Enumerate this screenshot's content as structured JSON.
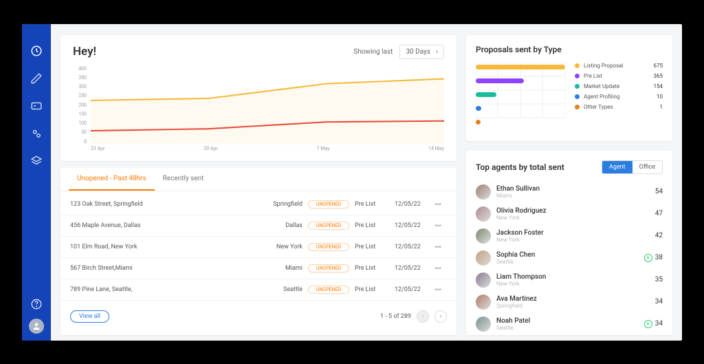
{
  "nav": {
    "items": [
      "dashboard",
      "edit",
      "card",
      "settings",
      "layers"
    ],
    "footer": [
      "help",
      "profile"
    ]
  },
  "chart_data": {
    "type": "line",
    "title": "",
    "xlabel": "",
    "ylabel": "",
    "ylim": [
      0,
      400
    ],
    "y_ticks": [
      400,
      350,
      300,
      250,
      200,
      150,
      100,
      50,
      0
    ],
    "categories": [
      "23 Apr",
      "30 Apr",
      "7 May",
      "14 May"
    ],
    "series": [
      {
        "name": "upper",
        "color": "#f6b93b",
        "values": [
          225,
          235,
          310,
          335
        ]
      },
      {
        "name": "lower",
        "color": "#e74c3c",
        "values": [
          70,
          80,
          115,
          120
        ]
      }
    ]
  },
  "header": {
    "greeting": "Hey!",
    "showing_label": "Showing last",
    "range_value": "30 Days"
  },
  "proposals_by_type": {
    "title": "Proposals sent by Type",
    "colors": {
      "listing": "#f6b93b",
      "prelist": "#8e44ff",
      "market": "#1abc9c",
      "agent": "#2a7de1",
      "other": "#e67e22"
    },
    "items": [
      {
        "key": "listing",
        "label": "Listing Proposal",
        "value": 675,
        "bar_pct": 100
      },
      {
        "key": "prelist",
        "label": "Pre List",
        "value": 365,
        "bar_pct": 54
      },
      {
        "key": "market",
        "label": "Market Update",
        "value": 154,
        "bar_pct": 23
      },
      {
        "key": "agent",
        "label": "Agent Profiling",
        "value": 10,
        "bar_pct": 6
      },
      {
        "key": "other",
        "label": "Other Types",
        "value": 1,
        "bar_pct": 0
      }
    ]
  },
  "tabs": {
    "active": "Unopened - Past 48hrs",
    "other": "Recently sent"
  },
  "table": {
    "status_label": "UNOPENED",
    "rows": [
      {
        "address": "123 Oak Street, Springfield",
        "city": "Springfield",
        "type": "Pre List",
        "date": "12/05/22"
      },
      {
        "address": "456 Maple Avenue, Dallas",
        "city": "Dallas",
        "type": "Pre List",
        "date": "12/05/22"
      },
      {
        "address": "101 Elm Road, New York",
        "city": "New York",
        "type": "Pre List",
        "date": "12/05/22"
      },
      {
        "address": "567 Birch Street,Miami",
        "city": "Miami",
        "type": "Pre List",
        "date": "12/05/22"
      },
      {
        "address": "789 Pine Lane, Seattle,",
        "city": "Seattle",
        "type": "Pre List",
        "date": "12/05/22"
      }
    ],
    "view_all": "View all",
    "page_label": "1 - 5 of 289"
  },
  "top_agents": {
    "title": "Top agents by total sent",
    "toggle": {
      "agent": "Agent",
      "office": "Office"
    },
    "list": [
      {
        "name": "Ethan Sullivan",
        "location": "Miami",
        "count": 54,
        "up": false
      },
      {
        "name": "Olivia Rodriguez",
        "location": "New York",
        "count": 47,
        "up": false
      },
      {
        "name": "Jackson Foster",
        "location": "New York",
        "count": 42,
        "up": false
      },
      {
        "name": "Sophia Chen",
        "location": "Seattle",
        "count": 38,
        "up": true
      },
      {
        "name": "Liam Thompson",
        "location": "New York",
        "count": 35,
        "up": false
      },
      {
        "name": "Ava Martinez",
        "location": "Springfield",
        "count": 34,
        "up": false
      },
      {
        "name": "Noah Patel",
        "location": "Seattle",
        "count": 34,
        "up": true
      }
    ]
  }
}
